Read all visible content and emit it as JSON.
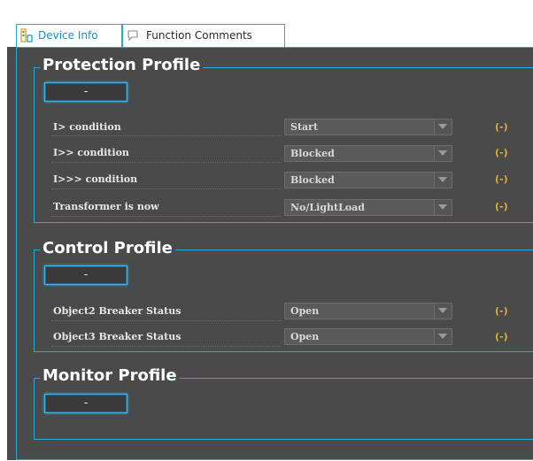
{
  "tabs": [
    {
      "label": "Device Info"
    },
    {
      "label": "Function Comments"
    }
  ],
  "sections": {
    "protection": {
      "title": "Protection Profile",
      "toggle": "-",
      "rows": [
        {
          "label": "I> condition",
          "value": "Start",
          "unit": "(-)"
        },
        {
          "label": "I>> condition",
          "value": "Blocked",
          "unit": "(-)"
        },
        {
          "label": "I>>> condition",
          "value": "Blocked",
          "unit": "(-)"
        },
        {
          "label": "Transformer is now",
          "value": "No/LightLoad",
          "unit": "(-)"
        }
      ]
    },
    "control": {
      "title": "Control Profile",
      "toggle": "-",
      "rows": [
        {
          "label": "Object2 Breaker Status",
          "value": "Open",
          "unit": "(-)"
        },
        {
          "label": "Object3 Breaker Status",
          "value": "Open",
          "unit": "(-)"
        }
      ]
    },
    "monitor": {
      "title": "Monitor Profile",
      "toggle": "-"
    }
  },
  "colors": {
    "accent": "#2aa7d6",
    "panel": "#4a4a4a",
    "unit": "#e0b12c"
  },
  "icons": {
    "device_info_tab": "device-info-icon",
    "function_comments_tab": "comment-icon",
    "dropdown": "chevron-down-icon"
  }
}
